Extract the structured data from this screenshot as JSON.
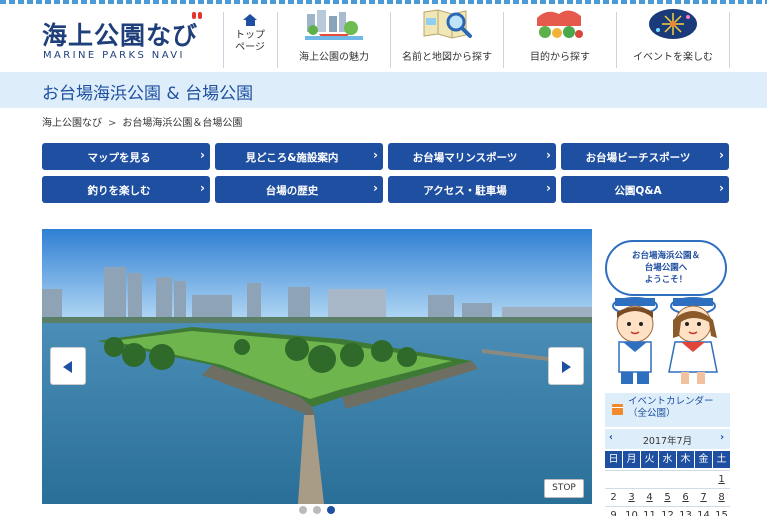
{
  "header": {
    "logo_main": "海上公園なび",
    "logo_sub": "MARINE PARKS NAVI",
    "home_line1": "トップ",
    "home_line2": "ページ",
    "nav": [
      {
        "label": "海上公園の魅力",
        "icon": "park-buildings-icon"
      },
      {
        "label": "名前と地図から探す",
        "icon": "map-search-icon"
      },
      {
        "label": "目的から探す",
        "icon": "activities-icon"
      },
      {
        "label": "イベントを楽しむ",
        "icon": "fireworks-icon"
      }
    ]
  },
  "title": "お台場海浜公園 & 台場公園",
  "breadcrumb": {
    "home": "海上公園なび",
    "separator": ">",
    "current": "お台場海浜公園＆台場公園"
  },
  "buttons": [
    "マップを見る",
    "見どころ&施設案内",
    "お台場マリンスポーツ",
    "お台場ビーチスポーツ",
    "釣りを楽しむ",
    "台場の歴史",
    "アクセス・駐車場",
    "公園Q&A"
  ],
  "button_chevron": "›",
  "slider": {
    "stop_label": "STOP",
    "slide_count": 3,
    "active_slide": 3
  },
  "mascot": {
    "line1": "お台場海浜公園＆",
    "line2": "台場公園へ",
    "line3": "ようこそ！"
  },
  "calendar": {
    "title_line1": "イベントカレンダー",
    "title_line2": "（全公園）",
    "prev": "‹",
    "next": "›",
    "month": "2017年7月",
    "weekdays": [
      "日",
      "月",
      "火",
      "水",
      "木",
      "金",
      "土"
    ],
    "row1": [
      "",
      "",
      "",
      "",
      "",
      "",
      "1"
    ],
    "row2": [
      "2",
      "3",
      "4",
      "5",
      "6",
      "7",
      "8"
    ],
    "row3": [
      "9",
      "10",
      "11",
      "12",
      "13",
      "14",
      "15"
    ]
  },
  "colors": {
    "primary": "#1f4fa0",
    "light_band": "#ddeefa",
    "logo": "#1f3f7a",
    "accent": "#e8322d"
  }
}
